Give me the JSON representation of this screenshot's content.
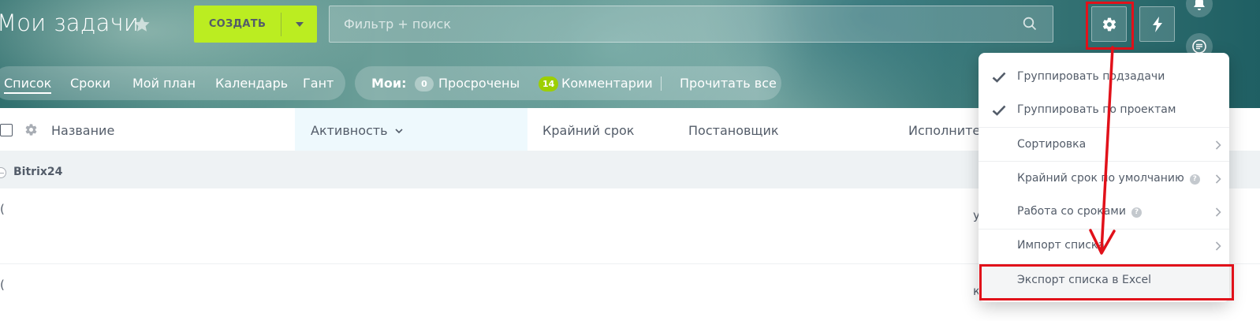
{
  "header": {
    "title": "Мои задачи",
    "create_label": "СОЗДАТЬ",
    "search_placeholder": "Фильтр + поиск"
  },
  "nav": {
    "tabs": [
      {
        "label": "Список",
        "active": true
      },
      {
        "label": "Сроки"
      },
      {
        "label": "Мой план"
      },
      {
        "label": "Календарь"
      },
      {
        "label": "Гант"
      }
    ]
  },
  "counters": {
    "prefix": "Мои:",
    "overdue_count": "0",
    "overdue_label": "Просрочены",
    "comments_count": "14",
    "comments_label": "Комментарии",
    "read_all": "Прочитать все"
  },
  "grid": {
    "columns": [
      "Название",
      "Активность",
      "Крайний срок",
      "Постановщик",
      "Исполнител"
    ],
    "group_name": "Bitrix24"
  },
  "settings_menu": {
    "items": [
      {
        "label": "Группировать подзадачи",
        "checked": true
      },
      {
        "label": "Группировать по проектам",
        "checked": true
      },
      {
        "label": "Сортировка",
        "submenu": true
      },
      {
        "label": "Крайний срок по умолчанию",
        "submenu": true,
        "help": true
      },
      {
        "label": "Работа со сроками",
        "submenu": true,
        "help": true
      },
      {
        "label": "Импорт списка",
        "submenu": true
      },
      {
        "label": "Экспорт списка в Excel",
        "hovered": true
      }
    ],
    "help_glyph": "?"
  },
  "stubs": {
    "paren": "(",
    "right_1": "у",
    "right_2": "к"
  },
  "colors": {
    "accent_green": "#bbed21",
    "badge_green": "#9dcf00",
    "highlight_red": "#e1111a",
    "text_dark": "#535c69"
  }
}
